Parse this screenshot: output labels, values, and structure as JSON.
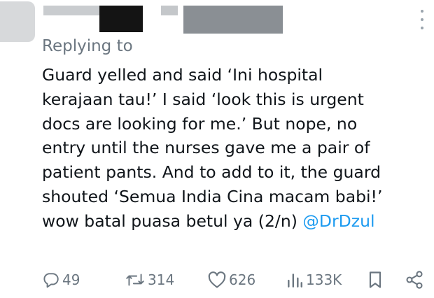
{
  "reply_context": {
    "label": "Replying to"
  },
  "tweet": {
    "lines": [
      "Guard yelled and said ‘Ini hospital",
      "kerajaan tau!’ I said ‘look this is urgent",
      "docs are looking for me.’ But nope, no",
      "entry until the nurses gave me a pair of",
      "patient pants. And to add to it, the guard",
      "shouted ‘Semua India Cina macam babi!’"
    ],
    "last_line_text": "wow batal puasa betul ya (2/n) ",
    "mention": "@DrDzul"
  },
  "actions": {
    "replies": "49",
    "retweets": "314",
    "likes": "626",
    "views": "133K"
  },
  "icons": {
    "reply": "reply-icon",
    "retweet": "retweet-icon",
    "like": "heart-icon",
    "views": "views-chart-icon",
    "bookmark": "bookmark-icon",
    "share": "share-icon",
    "more": "more-vertical-icon"
  },
  "colors": {
    "text": "#0f1419",
    "secondary": "#6b7680",
    "link": "#1d9bf0"
  }
}
